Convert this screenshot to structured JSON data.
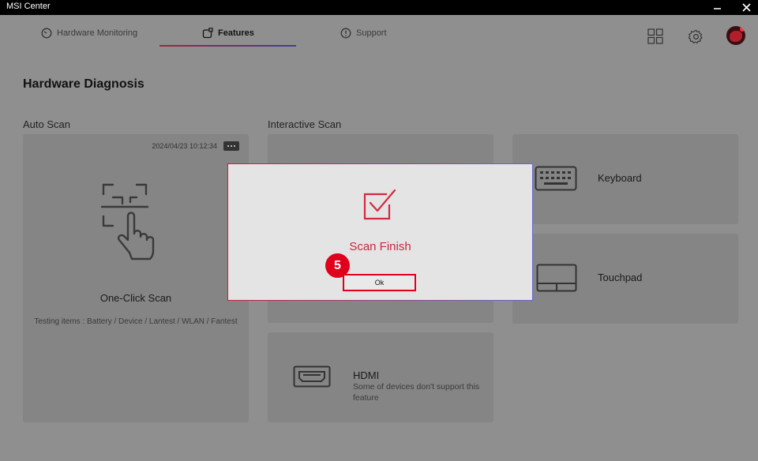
{
  "window": {
    "title": "MSI Center"
  },
  "tabs": [
    {
      "label": "Hardware Monitoring",
      "icon": "gauge-icon"
    },
    {
      "label": "Features",
      "icon": "features-icon"
    },
    {
      "label": "Support",
      "icon": "support-icon"
    }
  ],
  "page": {
    "title": "Hardware Diagnosis"
  },
  "auto_scan": {
    "section_label": "Auto Scan",
    "timestamp": "2024/04/23   10:12:34",
    "title": "One-Click Scan",
    "testing_items": "Testing items : Battery / Device / Lantest / WLAN / Fantest"
  },
  "interactive_scan": {
    "section_label": "Interactive Scan",
    "keyboard": {
      "label": "Keyboard"
    },
    "touchpad": {
      "label": "Touchpad"
    },
    "hdmi": {
      "label": "HDMI",
      "note": "Some of devices don't support this feature"
    }
  },
  "dialog": {
    "title": "Scan Finish",
    "ok_label": "Ok",
    "step_badge": "5"
  },
  "colors": {
    "accent_red": "#e0001b",
    "accent_blue": "#3b3f9e"
  }
}
